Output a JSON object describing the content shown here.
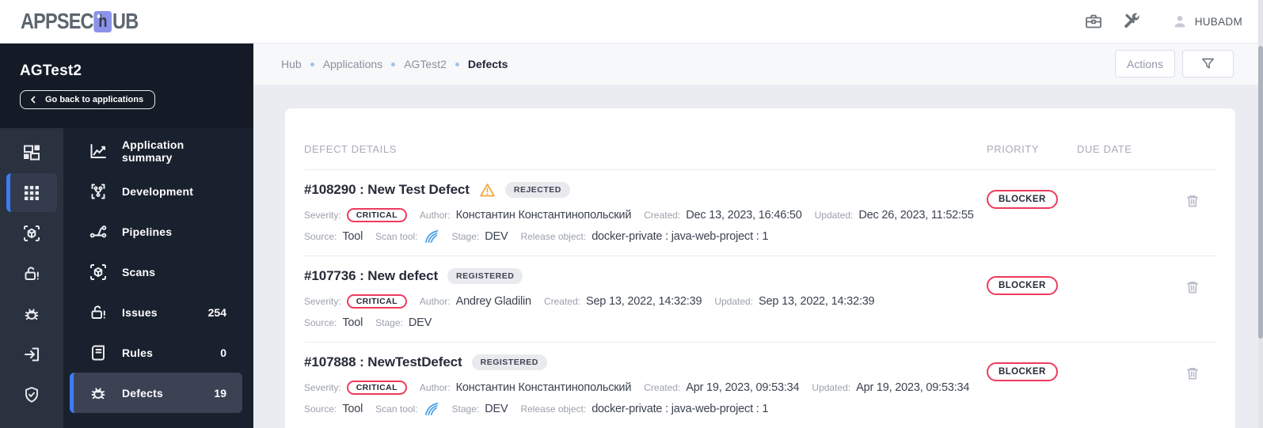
{
  "header": {
    "logo_pre": "APPSEC",
    "logo_mid": "h",
    "logo_post": "UB",
    "user": "HUBADM"
  },
  "sidebar": {
    "app_name": "AGTest2",
    "back_button": "Go back to applications",
    "menu": [
      {
        "label": "Application summary",
        "icon": "chart-line-icon",
        "count": ""
      },
      {
        "label": "Development",
        "icon": "dev-branch-icon",
        "count": ""
      },
      {
        "label": "Pipelines",
        "icon": "pipeline-fork-icon",
        "count": ""
      },
      {
        "label": "Scans",
        "icon": "cube-scan-icon",
        "count": ""
      },
      {
        "label": "Issues",
        "icon": "lock-alert-icon",
        "count": "254"
      },
      {
        "label": "Rules",
        "icon": "script-icon",
        "count": "0"
      },
      {
        "label": "Defects",
        "icon": "bug-icon",
        "count": "19",
        "active": true
      }
    ],
    "rail_icons": [
      "dashboard-icon",
      "apps-grid-icon",
      "cube-scan-icon",
      "lock-alert-icon",
      "bug-icon",
      "exit-icon",
      "shield-check-icon"
    ]
  },
  "breadcrumb": {
    "items": [
      "Hub",
      "Applications",
      "AGTest2",
      "Defects"
    ]
  },
  "toolbar": {
    "actions": "Actions"
  },
  "labels": {
    "severity": "Severity:",
    "author": "Author:",
    "created": "Created:",
    "updated": "Updated:",
    "source": "Source:",
    "scan_tool": "Scan tool:",
    "stage": "Stage:",
    "release": "Release object:"
  },
  "table": {
    "columns": [
      "DEFECT DETAILS",
      "PRIORITY",
      "DUE DATE"
    ],
    "rows": [
      {
        "title": "#108290 : New Test Defect",
        "status": "REJECTED",
        "severity": "CRITICAL",
        "author": "Константин Константинопольский",
        "created": "Dec 13, 2023, 16:46:50",
        "updated": "Dec 26, 2023, 11:52:55",
        "source": "Tool",
        "stage": "DEV",
        "release": "docker-private : java-web-project : 1",
        "priority": "BLOCKER",
        "due_date": ""
      },
      {
        "title": "#107736 : New defect",
        "status": "REGISTERED",
        "severity": "CRITICAL",
        "author": "Andrey Gladilin",
        "created": "Sep 13, 2022, 14:32:39",
        "updated": "Sep 13, 2022, 14:32:39",
        "source": "Tool",
        "stage": "DEV",
        "priority": "BLOCKER",
        "due_date": ""
      },
      {
        "title": "#107888 : NewTestDefect",
        "status": "REGISTERED",
        "severity": "CRITICAL",
        "author": "Константин Константинопольский",
        "created": "Apr 19, 2023, 09:53:34",
        "updated": "Apr 19, 2023, 09:53:34",
        "source": "Tool",
        "stage": "DEV",
        "release": "docker-private : java-web-project : 1",
        "priority": "BLOCKER",
        "due_date": ""
      }
    ]
  },
  "colors": {
    "accent_blue": "#3d7cf5",
    "pill_red": "#ee3a5e",
    "warning_orange": "#f1a33a",
    "scan_tool_blue": "#4ba1e9",
    "logo_purple": "#8a93e8",
    "sidebar_dark": "#1a212e"
  }
}
